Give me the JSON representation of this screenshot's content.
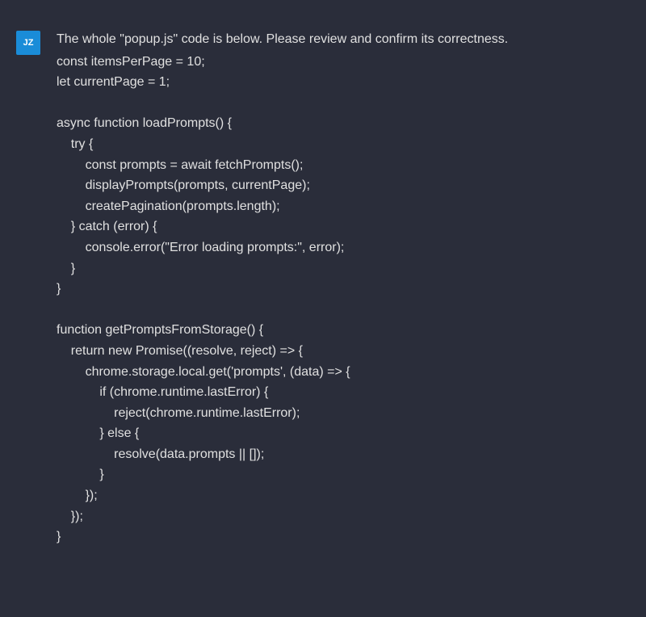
{
  "avatar": {
    "initials": "JZ"
  },
  "message": {
    "intro": "The whole \"popup.js\" code is below. Please review and confirm its correctness.",
    "code": "const itemsPerPage = 10;\nlet currentPage = 1;\n\nasync function loadPrompts() {\n    try {\n        const prompts = await fetchPrompts();\n        displayPrompts(prompts, currentPage);\n        createPagination(prompts.length);\n    } catch (error) {\n        console.error(\"Error loading prompts:\", error);\n    }\n}\n\nfunction getPromptsFromStorage() {\n    return new Promise((resolve, reject) => {\n        chrome.storage.local.get('prompts', (data) => {\n            if (chrome.runtime.lastError) {\n                reject(chrome.runtime.lastError);\n            } else {\n                resolve(data.prompts || []);\n            }\n        });\n    });\n}"
  }
}
